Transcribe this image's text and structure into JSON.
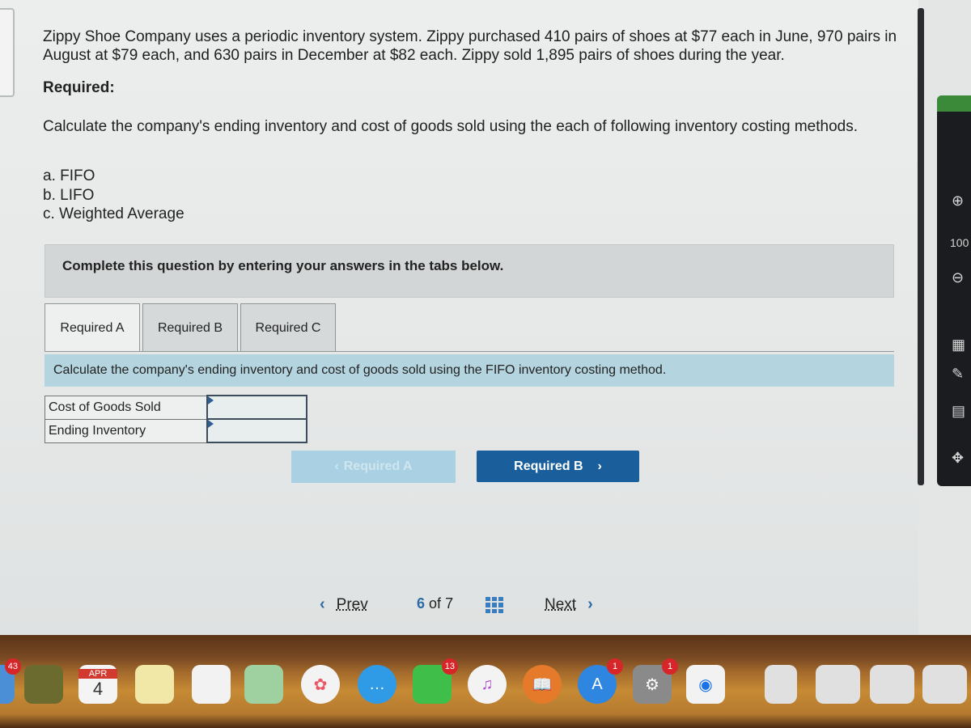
{
  "problem": {
    "text": "Zippy Shoe Company uses a periodic inventory system. Zippy purchased 410 pairs of shoes at $77 each in June, 970 pairs in August at $79 each, and 630 pairs in December at $82 each. Zippy sold 1,895 pairs of shoes during the year.",
    "required_heading": "Required:",
    "instruction": "Calculate the company's ending inventory and cost of goods sold using the each of following inventory costing methods.",
    "methods": [
      "a. FIFO",
      "b. LIFO",
      "c. Weighted Average"
    ]
  },
  "banner": {
    "text": "Complete this question by entering your answers in the tabs below."
  },
  "tabs": [
    {
      "label": "Required A",
      "active": true
    },
    {
      "label": "Required B",
      "active": false
    },
    {
      "label": "Required C",
      "active": false
    }
  ],
  "task": {
    "text": "Calculate the company's ending inventory and cost of goods sold using the FIFO inventory costing method."
  },
  "answers": [
    {
      "label": "Cost of Goods Sold",
      "value": ""
    },
    {
      "label": "Ending Inventory",
      "value": ""
    }
  ],
  "nav_buttons": {
    "prev_label": "Required A",
    "next_label": "Required B",
    "prev_icon": "‹",
    "next_icon": "›"
  },
  "pager": {
    "prev_label": "Prev",
    "next_label": "Next",
    "current": "6",
    "of_label": "of",
    "total": "7",
    "prev_icon": "‹",
    "next_icon": "›"
  },
  "side_toolbar": {
    "zoom_level": "100",
    "zoom_in_icon": "⊕",
    "zoom_out_icon": "⊖",
    "calculator_icon": "▦",
    "edit_icon": "✎",
    "comment_icon": "▤",
    "move_icon": "✥"
  },
  "dock": {
    "items": [
      {
        "name": "mail",
        "badge": "43",
        "color": "#4b8fd6"
      },
      {
        "name": "notebook",
        "badge": "",
        "color": "#6b6b2f"
      },
      {
        "name": "calendar",
        "badge": "",
        "color": "#f4f4f4",
        "month": "APR",
        "day": "4"
      },
      {
        "name": "notes",
        "badge": "",
        "color": "#f1e7a6"
      },
      {
        "name": "reminders",
        "badge": "",
        "color": "#f2f2f2"
      },
      {
        "name": "maps",
        "badge": "",
        "color": "#9fd0a0"
      },
      {
        "name": "photos",
        "badge": "",
        "color": "#f3f3f3"
      },
      {
        "name": "messages",
        "badge": "",
        "color": "#2f9be6"
      },
      {
        "name": "facetime",
        "badge": "13",
        "color": "#3fbf4a"
      },
      {
        "name": "itunes",
        "badge": "",
        "color": "#f3f3f3"
      },
      {
        "name": "ibooks",
        "badge": "",
        "color": "#e57a2a"
      },
      {
        "name": "app-store",
        "badge": "1",
        "color": "#2f86e0"
      },
      {
        "name": "system-preferences",
        "badge": "1",
        "color": "#8a8a8a"
      },
      {
        "name": "chrome",
        "badge": "",
        "color": "#f2f2f2"
      },
      {
        "name": "document",
        "badge": "",
        "color": "#e0e0e0"
      },
      {
        "name": "file-1",
        "badge": "",
        "color": "#e0e0e0"
      },
      {
        "name": "file-2",
        "badge": "",
        "color": "#e0e0e0"
      },
      {
        "name": "file-3",
        "badge": "",
        "color": "#e0e0e0"
      }
    ]
  }
}
